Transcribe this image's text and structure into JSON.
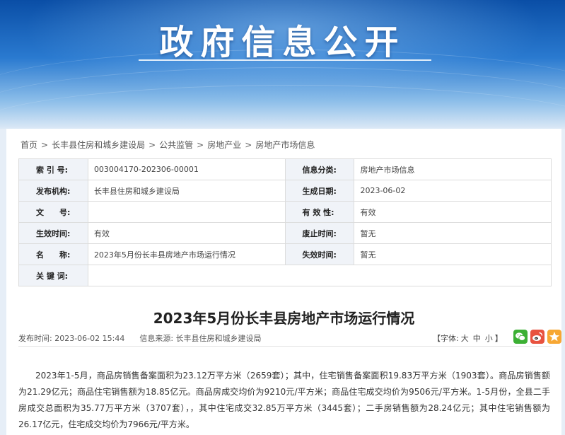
{
  "banner": {
    "title": "政府信息公开"
  },
  "breadcrumb": [
    "首页",
    "长丰县住房和城乡建设局",
    "公共监管",
    "房地产业",
    "房地产市场信息"
  ],
  "meta": {
    "rows": [
      {
        "l1": "索 引 号:",
        "v1": "003004170-202306-00001",
        "l2": "信息分类:",
        "v2": "房地产市场信息"
      },
      {
        "l1": "发布机构:",
        "v1": "长丰县住房和城乡建设局",
        "l2": "生成日期:",
        "v2": "2023-06-02"
      },
      {
        "l1": "文　　号:",
        "v1": "",
        "l2": "有 效 性:",
        "v2": "有效"
      },
      {
        "l1": "生效时间:",
        "v1": "有效",
        "l2": "废止时间:",
        "v2": "暂无"
      },
      {
        "l1": "名　　称:",
        "v1": "2023年5月份长丰县房地产市场运行情况",
        "l2": "失效时间:",
        "v2": "暂无"
      },
      {
        "l1": "关 键 词:",
        "v1": ""
      }
    ]
  },
  "article": {
    "title": "2023年5月份长丰县房地产市场运行情况",
    "publish_label": "发布时间:",
    "publish_time": "2023-06-02 15:44",
    "source_label": "信息来源:",
    "source": "长丰县住房和城乡建设局",
    "font_label_open": "【字体:",
    "font_large": "大",
    "font_medium": "中",
    "font_small": "小",
    "font_label_close": "】",
    "body": "2023年1-5月，商品房销售备案面积为23.12万平方米（2659套）；其中，住宅销售备案面积19.83万平方米（1903套）。商品房销售额为21.29亿元；商品住宅销售额为18.85亿元。商品房成交均价为9210元/平方米；商品住宅成交均价为9506元/平方米。1-5月份，全县二手房成交总面积为35.77万平方米（3707套），，其中住宅成交32.85万平方米（3445套）；二手房销售额为28.24亿元；其中住宅销售额为26.17亿元，住宅成交均价为7966元/平方米。"
  },
  "share": {
    "wechat_icon": "wechat-icon",
    "weibo_icon": "weibo-icon",
    "favorite_icon": "star-icon"
  }
}
